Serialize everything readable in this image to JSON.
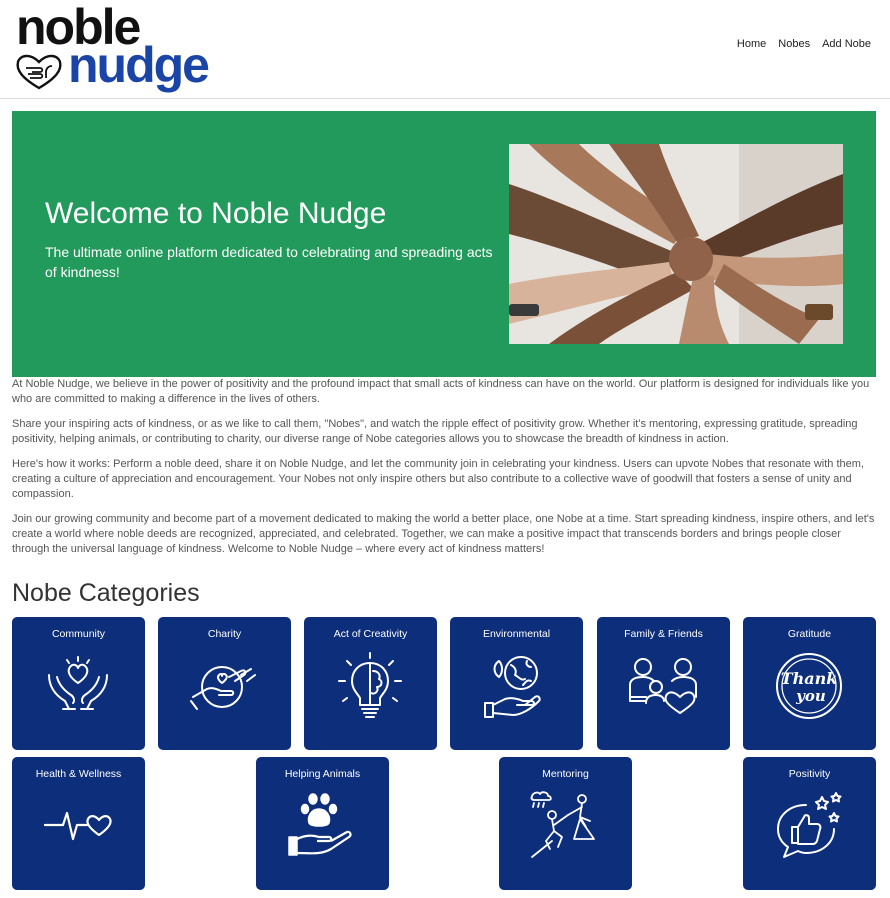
{
  "logo": {
    "line1": "noble",
    "line2": "nudge"
  },
  "nav": {
    "items": [
      "Home",
      "Nobes",
      "Add Nobe"
    ]
  },
  "hero": {
    "title": "Welcome to Noble Nudge",
    "subtitle": "The ultimate online platform dedicated to celebrating and spreading acts of kindness!"
  },
  "body": {
    "paragraphs": [
      "At Noble Nudge, we believe in the power of positivity and the profound impact that small acts of kindness can have on the world. Our platform is designed for individuals like you who are committed to making a difference in the lives of others.",
      "Share your inspiring acts of kindness, or as we like to call them, \"Nobes\", and watch the ripple effect of positivity grow. Whether it's mentoring, expressing gratitude, spreading positivity, helping animals, or contributing to charity, our diverse range of Nobe categories allows you to showcase the breadth of kindness in action.",
      "Here's how it works: Perform a noble deed, share it on Noble Nudge, and let the community join in celebrating your kindness. Users can upvote Nobes that resonate with them, creating a culture of appreciation and encouragement. Your Nobes not only inspire others but also contribute to a collective wave of goodwill that fosters a sense of unity and compassion.",
      "Join our growing community and become part of a movement dedicated to making the world a better place, one Nobe at a time. Start spreading kindness, inspire others, and let's create a world where noble deeds are recognized, appreciated, and celebrated. Together, we can make a positive impact that transcends borders and brings people closer through the universal language of kindness. Welcome to Noble Nudge – where every act of kindness matters!"
    ]
  },
  "categories": {
    "title": "Nobe Categories",
    "items": [
      {
        "label": "Community",
        "icon": "hands-heart-icon"
      },
      {
        "label": "Charity",
        "icon": "giving-hand-icon"
      },
      {
        "label": "Act of Creativity",
        "icon": "lightbulb-brain-icon"
      },
      {
        "label": "Environmental",
        "icon": "earth-hand-icon"
      },
      {
        "label": "Family & Friends",
        "icon": "family-icon"
      },
      {
        "label": "Gratitude",
        "icon": "thank-you-icon"
      },
      {
        "label": "Health & Wellness",
        "icon": "heartbeat-icon"
      },
      {
        "label": "Helping Animals",
        "icon": "paw-hand-icon"
      },
      {
        "label": "Mentoring",
        "icon": "climbing-help-icon"
      },
      {
        "label": "Positivity",
        "icon": "thumbs-up-icon"
      }
    ]
  },
  "colors": {
    "hero": "#229a5b",
    "card": "#0d2e7a",
    "brand_blue": "#1a44a6"
  }
}
